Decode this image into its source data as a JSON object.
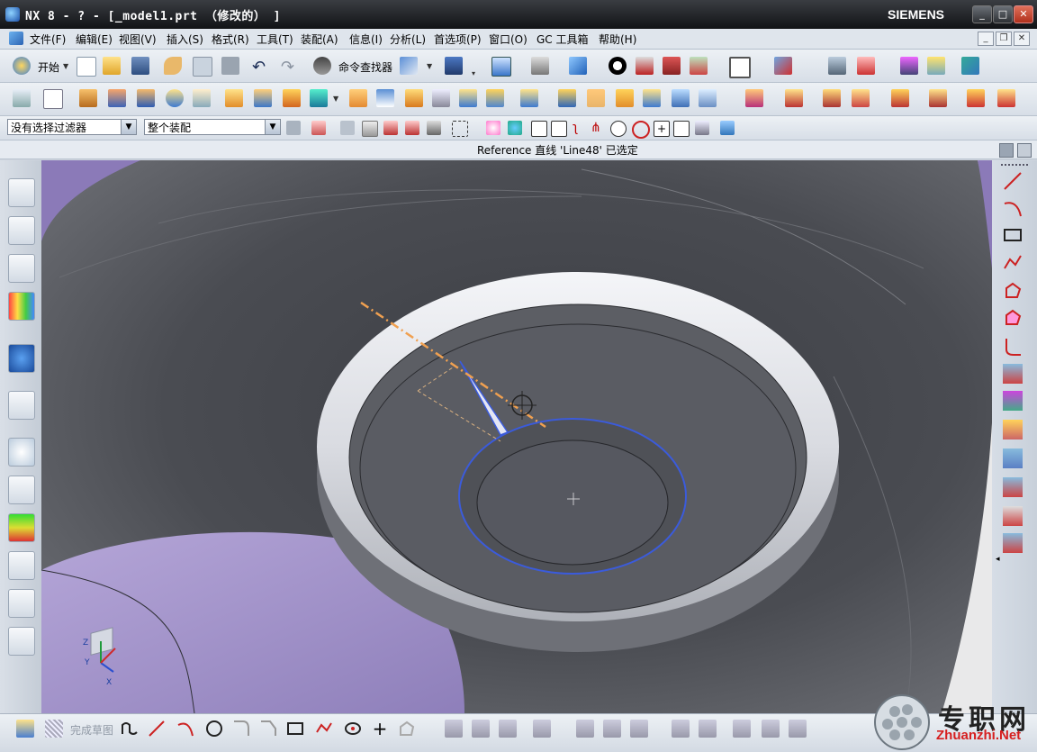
{
  "window": {
    "title": "NX 8 - ? - [_model1.prt （修改的） ]",
    "brand": "SIEMENS",
    "controls": [
      "_",
      "□",
      "✕"
    ]
  },
  "menu": {
    "items": [
      "文件(F)",
      "编辑(E)",
      "视图(V)",
      "插入(S)",
      "格式(R)",
      "工具(T)",
      "装配(A)",
      "信息(I)",
      "分析(L)",
      "首选项(P)",
      "窗口(O)",
      "GC 工具箱",
      "帮助(H)"
    ]
  },
  "toolbar": {
    "start_label": "开始",
    "command_finder_label": "命令查找器"
  },
  "selection": {
    "filter_value": "没有选择过滤器",
    "scope_value": "整个装配"
  },
  "status": {
    "message": "Reference 直线 'Line48' 已选定"
  },
  "sketch_bar": {
    "finish_label": "完成草图"
  },
  "watermark": {
    "cn": "专职网",
    "url": "Zhuanzhi.Net"
  },
  "triad": {
    "z": "Z",
    "y": "Y",
    "x": "X"
  },
  "colors": {
    "title_bg": "#1b1d21",
    "toolbar_bg": "#e3e8ee",
    "model_dark": "#55575c",
    "model_light": "#e9eaee",
    "highlight_blue": "#3b5bdb",
    "reference_line": "#f0a050",
    "purple_face": "#a898c8"
  }
}
